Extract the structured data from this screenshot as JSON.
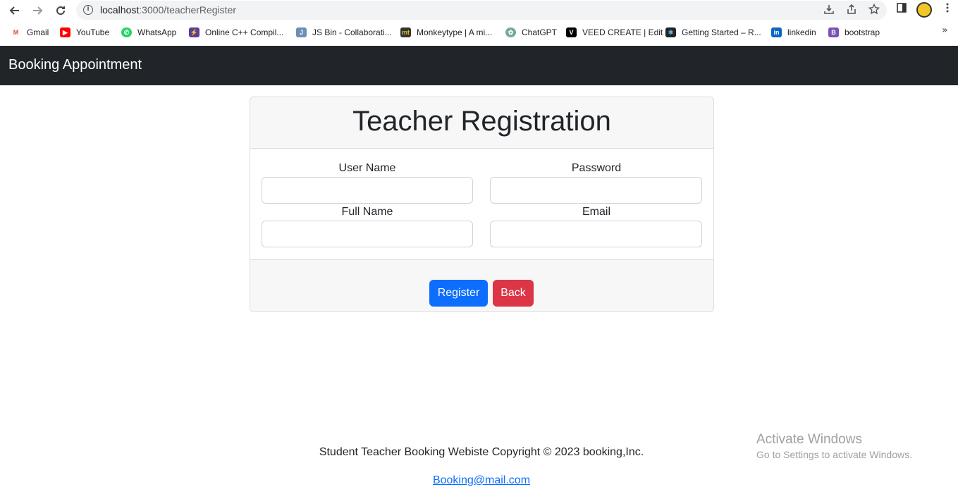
{
  "browser": {
    "url_host": "localhost",
    "url_rest": ":3000/teacherRegister",
    "bookmarks": [
      {
        "label": "Gmail",
        "icon": "gmail-icon",
        "color": "#ea4335"
      },
      {
        "label": "YouTube",
        "icon": "youtube-icon",
        "color": "#ff0000"
      },
      {
        "label": "WhatsApp",
        "icon": "whatsapp-icon",
        "color": "#25d366"
      },
      {
        "label": "Online C++ Compil...",
        "icon": "lightning-icon",
        "color": "#5b3e96"
      },
      {
        "label": "JS Bin - Collaborati...",
        "icon": "jsbin-icon",
        "color": "#6b8fb5"
      },
      {
        "label": "Monkeytype | A mi...",
        "icon": "monkeytype-icon",
        "color": "#323437"
      },
      {
        "label": "ChatGPT",
        "icon": "chatgpt-icon",
        "color": "#74aa9c"
      },
      {
        "label": "VEED CREATE | Edit",
        "icon": "veed-icon",
        "color": "#000000"
      },
      {
        "label": "Getting Started – R...",
        "icon": "react-icon",
        "color": "#20232a"
      },
      {
        "label": "linkedin",
        "icon": "linkedin-icon",
        "color": "#0a66c2"
      },
      {
        "label": "bootstrap",
        "icon": "bootstrap-icon",
        "color": "#7952b3"
      }
    ],
    "more_glyph": "»"
  },
  "navbar": {
    "brand": "Booking Appointment"
  },
  "form": {
    "title": "Teacher Registration",
    "fields": {
      "username": {
        "label": "User Name",
        "value": ""
      },
      "password": {
        "label": "Password",
        "value": ""
      },
      "fullname": {
        "label": "Full Name",
        "value": ""
      },
      "email": {
        "label": "Email",
        "value": ""
      }
    },
    "register_label": "Register",
    "back_label": "Back"
  },
  "footer": {
    "copyright": "Student Teacher Booking Webiste Copyright © 2023 booking,Inc.",
    "email_link": "Booking@mail.com"
  },
  "watermark": {
    "title": "Activate Windows",
    "subtitle": "Go to Settings to activate Windows."
  },
  "colors": {
    "navbar": "#212529",
    "primary": "#0d6efd",
    "danger": "#dc3545"
  }
}
